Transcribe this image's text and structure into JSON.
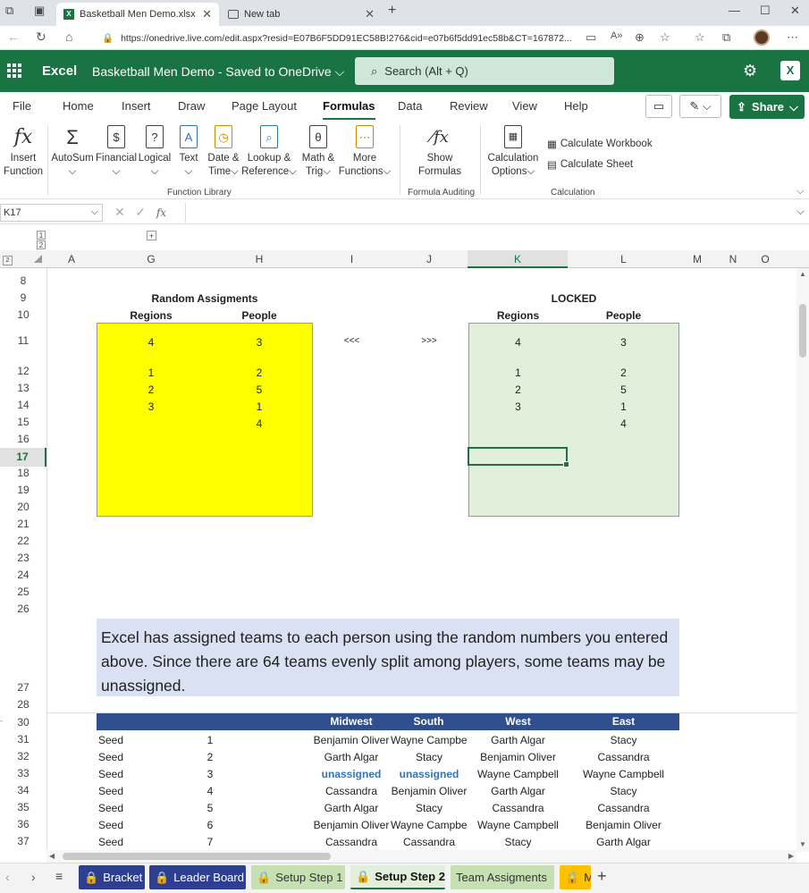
{
  "browser": {
    "tabs": [
      {
        "label": "Basketball Men Demo.xlsx - Micr",
        "active": true
      },
      {
        "label": "New tab",
        "active": false
      }
    ],
    "url": "https://onedrive.live.com/edit.aspx?resid=E07B6F5DD91EC58B!276&cid=e07b6f5dd91ec58b&CT=167872..."
  },
  "excel": {
    "app_name": "Excel",
    "doc_title": "Basketball Men Demo  -  Saved to OneDrive",
    "search_placeholder": "Search (Alt + Q)",
    "share_label": "Share"
  },
  "ribbon_tabs": [
    "File",
    "Home",
    "Insert",
    "Draw",
    "Page Layout",
    "Formulas",
    "Data",
    "Review",
    "View",
    "Help"
  ],
  "active_ribbon_tab": "Formulas",
  "ribbon": {
    "insert_function": [
      "Insert",
      "Function"
    ],
    "autosum": "AutoSum",
    "financial": "Financial",
    "logical": "Logical",
    "text": "Text",
    "datetime": [
      "Date &",
      "Time"
    ],
    "lookup": [
      "Lookup &",
      "Reference"
    ],
    "math": [
      "Math &",
      "Trig"
    ],
    "more": [
      "More",
      "Functions"
    ],
    "show_formulas": [
      "Show",
      "Formulas"
    ],
    "calc_options": [
      "Calculation",
      "Options"
    ],
    "calc_workbook": "Calculate Workbook",
    "calc_sheet": "Calculate Sheet",
    "group_function_library": "Function Library",
    "group_formula_auditing": "Formula Auditing",
    "group_calculation": "Calculation"
  },
  "formula_bar": {
    "name_box": "K17",
    "fx": "fx",
    "formula": ""
  },
  "grid": {
    "outline_levels": [
      "1",
      "2"
    ],
    "outline_expand": "+",
    "corner_level": "2",
    "columns": [
      "A",
      "G",
      "H",
      "I",
      "J",
      "K",
      "L",
      "M",
      "N",
      "O"
    ],
    "selected_column": "K",
    "rows": [
      "8",
      "9",
      "10",
      "11",
      "12",
      "13",
      "14",
      "15",
      "16",
      "17",
      "18",
      "19",
      "20",
      "21",
      "22",
      "23",
      "24",
      "25",
      "26",
      "27",
      "28",
      "30",
      "31",
      "32",
      "33",
      "34",
      "35",
      "36",
      "37"
    ],
    "selected_row": "17"
  },
  "content": {
    "random_title": "Random Assigments",
    "locked_title": "LOCKED",
    "regions_label": "Regions",
    "people_label": "People",
    "arrow_left": "<<<",
    "arrow_right": ">>>",
    "random_regions": [
      "4",
      "1",
      "2",
      "3"
    ],
    "random_people": [
      "3",
      "2",
      "5",
      "1",
      "4"
    ],
    "locked_regions": [
      "4",
      "1",
      "2",
      "3"
    ],
    "locked_people": [
      "3",
      "2",
      "5",
      "1",
      "4"
    ],
    "note": "Excel has assigned teams to each person using the random numbers you entered above. Since there are 64 teams evenly split among players, some teams may be unassigned.",
    "table_headers": [
      "Midwest",
      "South",
      "West",
      "East"
    ],
    "seeds": [
      {
        "label": "Seed",
        "num": "1",
        "midwest": "Benjamin Oliver",
        "south": "Wayne Campbell",
        "west": "Garth Algar",
        "east": "Stacy"
      },
      {
        "label": "Seed",
        "num": "2",
        "midwest": "Garth Algar",
        "south": "Stacy",
        "west": "Benjamin Oliver",
        "east": "Cassandra"
      },
      {
        "label": "Seed",
        "num": "3",
        "midwest": "unassigned",
        "south": "unassigned",
        "west": "Wayne Campbell",
        "east": "Wayne Campbell"
      },
      {
        "label": "Seed",
        "num": "4",
        "midwest": "Cassandra",
        "south": "Benjamin Oliver",
        "west": "Garth Algar",
        "east": "Stacy"
      },
      {
        "label": "Seed",
        "num": "5",
        "midwest": "Garth Algar",
        "south": "Stacy",
        "west": "Cassandra",
        "east": "Cassandra"
      },
      {
        "label": "Seed",
        "num": "6",
        "midwest": "Benjamin Oliver",
        "south": "Wayne Campbell",
        "west": "Wayne Campbell",
        "east": "Benjamin Oliver"
      },
      {
        "label": "Seed",
        "num": "7",
        "midwest": "Cassandra",
        "south": "Cassandra",
        "west": "Stacy",
        "east": "Garth Algar"
      }
    ]
  },
  "sheet_tabs": [
    {
      "label": "Bracket",
      "color": "#2f3f8f",
      "locked": true
    },
    {
      "label": "Leader Board",
      "color": "#2f3f8f",
      "locked": true
    },
    {
      "label": "Setup Step 1",
      "color": "#c6e0b4",
      "locked": true
    },
    {
      "label": "Setup Step 2",
      "color": "#c6e0b4",
      "locked": true,
      "active": true
    },
    {
      "label": "Team Assigments",
      "color": "#c6e0b4",
      "locked": false
    },
    {
      "label": "M",
      "color": "#ffc000",
      "locked": true
    }
  ],
  "colors": {
    "excel_green": "#1a7342",
    "yellow": "#ffff00",
    "locked_green": "#e2efda",
    "table_header": "#2f4f8f",
    "note_bg": "#d9e1f2",
    "unassigned": "#2e75b6"
  }
}
